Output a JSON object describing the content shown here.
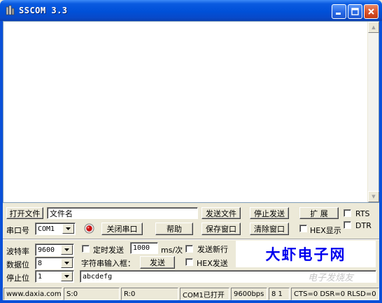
{
  "window": {
    "title": "SSCOM 3.3",
    "icon": "sscom-app-icon",
    "controls": [
      "minimize-icon",
      "maximize-icon",
      "close-icon"
    ]
  },
  "receive_area": {
    "text": ""
  },
  "row1": {
    "open_file_label": "打开文件",
    "file_name_value": "文件名",
    "send_file_label": "发送文件",
    "stop_send_label": "停止发送",
    "expand_label": "扩 展",
    "rts_label": "RTS",
    "dtr_label": "DTR"
  },
  "row2": {
    "port_label": "串口号",
    "port_value": "COM1",
    "close_port_label": "关闭串口",
    "help_label": "帮助",
    "save_window_label": "保存窗口",
    "clear_window_label": "清除窗口",
    "hex_display_label": "HEX显示"
  },
  "settings": {
    "baud_label": "波特率",
    "baud_value": "9600",
    "data_bits_label": "数据位",
    "data_bits_value": "8",
    "stop_bits_label": "停止位",
    "stop_bits_value": "1"
  },
  "send_panel": {
    "timed_send_label": "定时发送",
    "interval_value": "1000",
    "interval_unit": "ms/次",
    "send_newline_label": "发送新行",
    "input_label": "字符串输入框：",
    "send_button_label": "发送",
    "hex_send_label": "HEX发送",
    "input_value": "abcdefg"
  },
  "logo": {
    "text": "大虾电子网"
  },
  "statusbar": {
    "website": "www.daxia.com",
    "sent": "S:0",
    "received": "R:0",
    "port_status": "COM1已打开",
    "baud_info": "9600bps",
    "frame_info": "8 1",
    "cts_info": "CTS=0 DSR=0 RLSD=0"
  },
  "watermark": "电子发烧友",
  "colors": {
    "titlebar": "#0050d8",
    "face": "#ece9d8",
    "logo_text": "#0000ee",
    "port_indicator": "#cc1010"
  }
}
